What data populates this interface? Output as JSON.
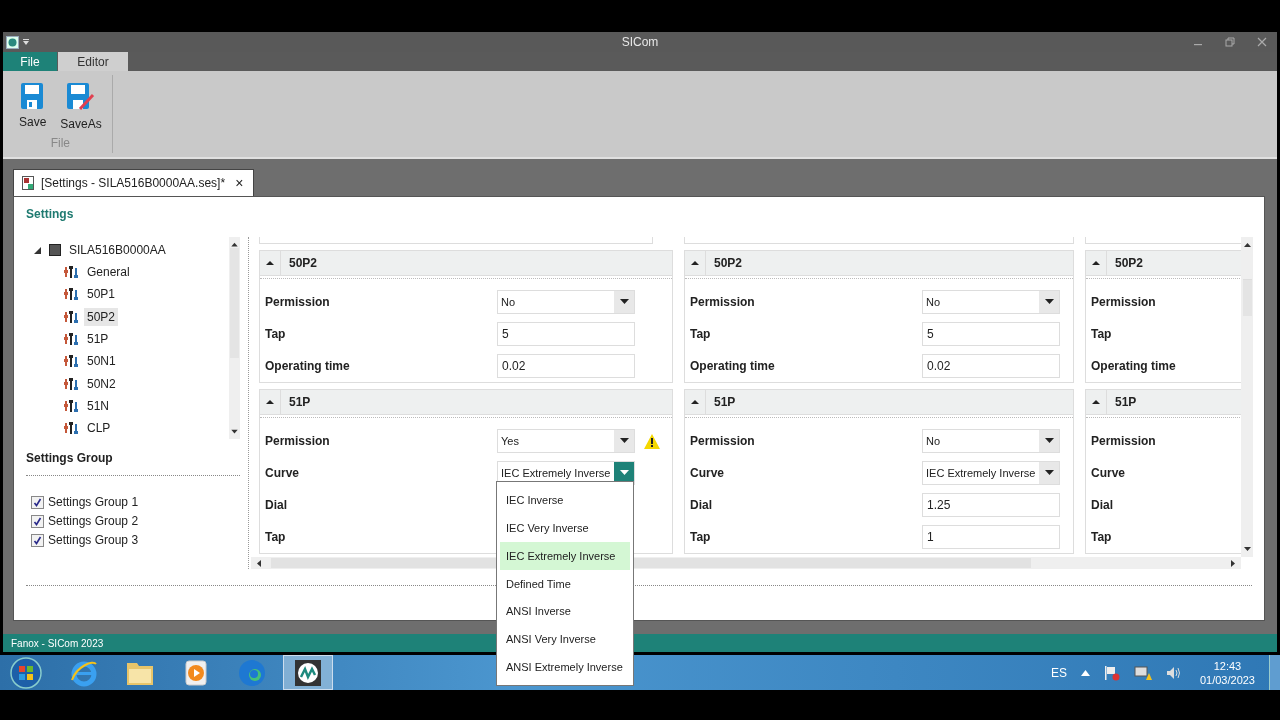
{
  "window": {
    "title": "SICom"
  },
  "ribbon": {
    "tabs": [
      {
        "label": "File",
        "selected": true
      },
      {
        "label": "Editor",
        "selected": false
      }
    ],
    "buttons": [
      {
        "label": "Save",
        "kind": "save"
      },
      {
        "label": "SaveAs",
        "kind": "saveas"
      }
    ],
    "group_label": "File"
  },
  "document_tab": {
    "title": "[Settings - SILA516B0000AA.ses]*",
    "close": "×"
  },
  "settings_heading": "Settings",
  "tree": {
    "label": "SILA516B0000AA",
    "expanded": true,
    "children": [
      {
        "label": "General",
        "selected": false
      },
      {
        "label": "50P1",
        "selected": false
      },
      {
        "label": "50P2",
        "selected": true
      },
      {
        "label": "51P",
        "selected": false
      },
      {
        "label": "50N1",
        "selected": false
      },
      {
        "label": "50N2",
        "selected": false
      },
      {
        "label": "51N",
        "selected": false
      },
      {
        "label": "CLP",
        "selected": false
      }
    ]
  },
  "settings_group": {
    "heading": "Settings Group",
    "items": [
      {
        "label": "Settings Group 1",
        "checked": true
      },
      {
        "label": "Settings Group 2",
        "checked": true
      },
      {
        "label": "Settings Group 3",
        "checked": true
      }
    ]
  },
  "columns": [
    {
      "sections": [
        {
          "title": "50P2",
          "expanded": true,
          "rows": [
            {
              "label": "Permission",
              "kind": "select",
              "value": "No"
            },
            {
              "label": "Tap",
              "kind": "input",
              "value": "5"
            },
            {
              "label": "Operating time",
              "kind": "input",
              "value": "0.02"
            }
          ]
        },
        {
          "title": "51P",
          "expanded": true,
          "rows": [
            {
              "label": "Permission",
              "kind": "select",
              "value": "Yes",
              "warning": true
            },
            {
              "label": "Curve",
              "kind": "select",
              "value": "IEC Extremely Inverse",
              "open": true
            },
            {
              "label": "Dial"
            },
            {
              "label": "Tap"
            }
          ]
        }
      ]
    },
    {
      "sections": [
        {
          "title": "50P2",
          "expanded": true,
          "rows": [
            {
              "label": "Permission",
              "kind": "select",
              "value": "No"
            },
            {
              "label": "Tap",
              "kind": "input",
              "value": "5"
            },
            {
              "label": "Operating time",
              "kind": "input",
              "value": "0.02"
            }
          ]
        },
        {
          "title": "51P",
          "expanded": true,
          "rows": [
            {
              "label": "Permission",
              "kind": "select",
              "value": "No"
            },
            {
              "label": "Curve",
              "kind": "select",
              "value": "IEC Extremely Inverse"
            },
            {
              "label": "Dial",
              "kind": "input",
              "value": "1.25"
            },
            {
              "label": "Tap",
              "kind": "input",
              "value": "1"
            }
          ]
        }
      ]
    },
    {
      "sections": [
        {
          "title": "50P2",
          "expanded": true,
          "rows": [
            {
              "label": "Permission"
            },
            {
              "label": "Tap"
            },
            {
              "label": "Operating time"
            }
          ]
        },
        {
          "title": "51P",
          "expanded": true,
          "rows": [
            {
              "label": "Permission"
            },
            {
              "label": "Curve"
            },
            {
              "label": "Dial"
            },
            {
              "label": "Tap"
            }
          ]
        }
      ]
    }
  ],
  "dropdown": {
    "options": [
      {
        "label": "IEC Inverse",
        "selected": false
      },
      {
        "label": "IEC Very Inverse",
        "selected": false
      },
      {
        "label": "IEC Extremely Inverse",
        "selected": true
      },
      {
        "label": "Defined Time",
        "selected": false
      },
      {
        "label": "ANSI Inverse",
        "selected": false
      },
      {
        "label": "ANSI Very Inverse",
        "selected": false
      },
      {
        "label": "ANSI Extremely Inverse",
        "selected": false
      }
    ]
  },
  "status_bar": "Fanox  -  SICom 2023",
  "taskbar": {
    "apps": [
      {
        "kind": "browser",
        "selected": false
      },
      {
        "kind": "folder",
        "selected": false
      },
      {
        "kind": "player",
        "selected": false
      },
      {
        "kind": "edge",
        "selected": false
      },
      {
        "kind": "sicom",
        "selected": true
      }
    ],
    "language": "ES",
    "time": "12:43",
    "date": "01/03/2023"
  }
}
